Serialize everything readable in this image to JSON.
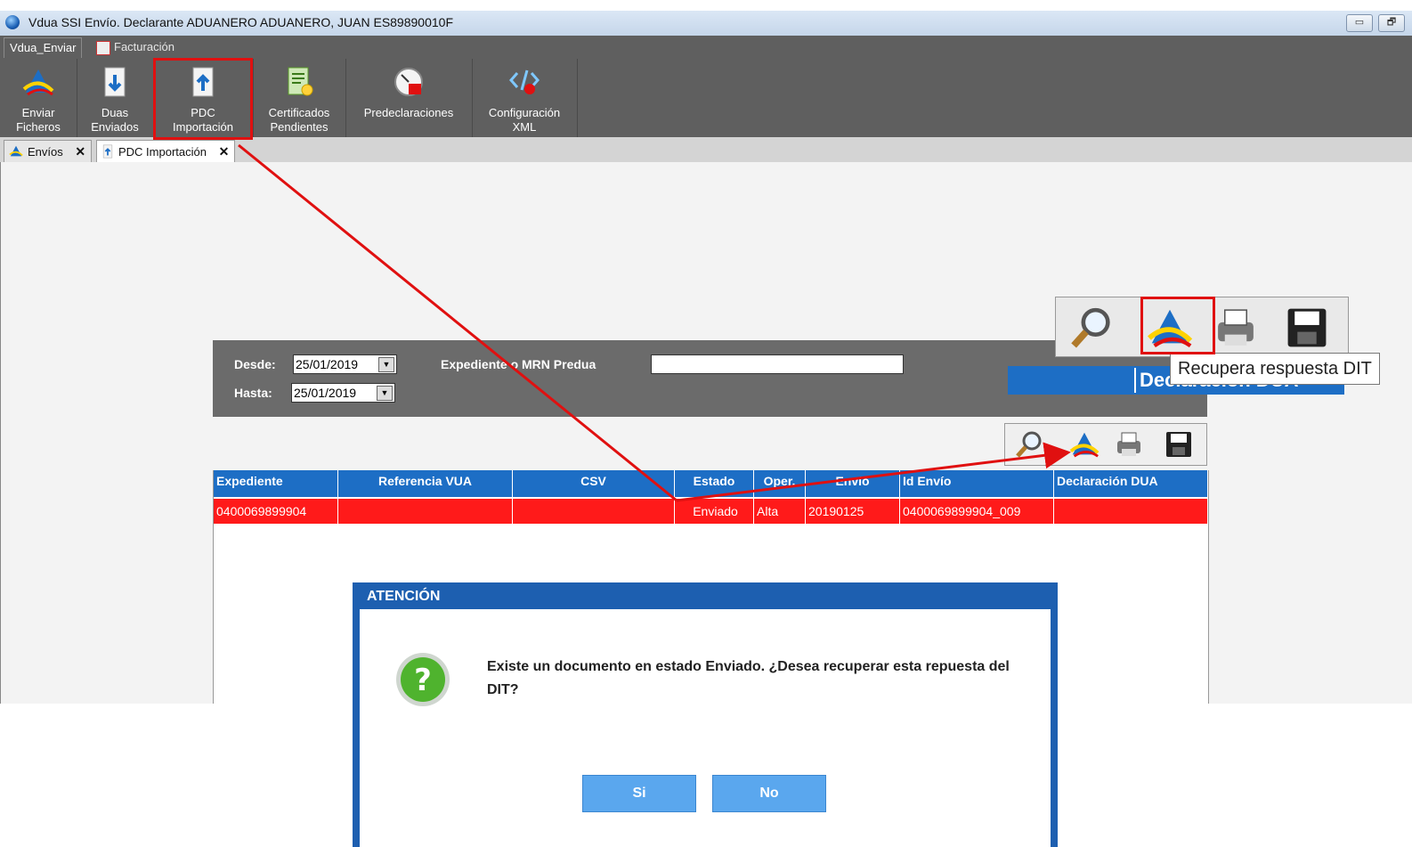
{
  "window": {
    "title": "Vdua SSI Envío. Declarante  ADUANERO ADUANERO, JUAN  ES89890010F",
    "minimize_glyph": "▭",
    "restore_glyph": "🗗"
  },
  "ribbon": {
    "tabs": [
      {
        "label": "Vdua_Enviar"
      },
      {
        "label": "Facturación"
      }
    ],
    "buttons": [
      {
        "label": "Enviar\nFicheros",
        "icon": "aeat-logo-icon"
      },
      {
        "label": "Duas\nEnviados",
        "icon": "document-download-icon"
      },
      {
        "label": "PDC\nImportación",
        "icon": "document-upload-icon"
      },
      {
        "label": "Certificados\nPendientes",
        "icon": "certificate-icon"
      },
      {
        "label": "Predeclaraciones",
        "icon": "gauge-icon"
      },
      {
        "label": "Configuración\nXML",
        "icon": "xml-config-icon"
      }
    ]
  },
  "doc_tabs": [
    {
      "label": "Envíos",
      "close": "✕"
    },
    {
      "label": "PDC Importación",
      "close": "✕"
    }
  ],
  "filter": {
    "desde_label": "Desde:",
    "desde_value": "25/01/2019",
    "hasta_label": "Hasta:",
    "hasta_value": "25/01/2019",
    "expediente_label": "Expediente o MRN Predua",
    "expediente_value": ""
  },
  "table": {
    "columns": [
      "Expediente",
      "Referencia VUA",
      "CSV",
      "Estado",
      "Oper.",
      "Envío",
      "Id Envío",
      "Declaración DUA"
    ],
    "rows": [
      [
        "0400069899904",
        "",
        "",
        "Enviado",
        "Alta",
        "20190125",
        "0400069899904_009",
        ""
      ]
    ]
  },
  "toolbar_icons": [
    "search-icon",
    "aeat-recover-icon",
    "print-icon",
    "save-icon"
  ],
  "tooltip": "Recupera respuesta DIT",
  "zoom_header": "Declaración DUA",
  "dialog": {
    "title": "ATENCIÓN",
    "message": "Existe un documento en estado Enviado. ¿Desea recuperar esta repuesta del DIT?",
    "icon": "question-icon",
    "yes_label": "Si",
    "no_label": "No"
  },
  "colors": {
    "highlight": "#e01010",
    "header_blue": "#1d6ec5",
    "row_red": "#ff1a1a",
    "ribbon_gray": "#5f5f5f"
  }
}
